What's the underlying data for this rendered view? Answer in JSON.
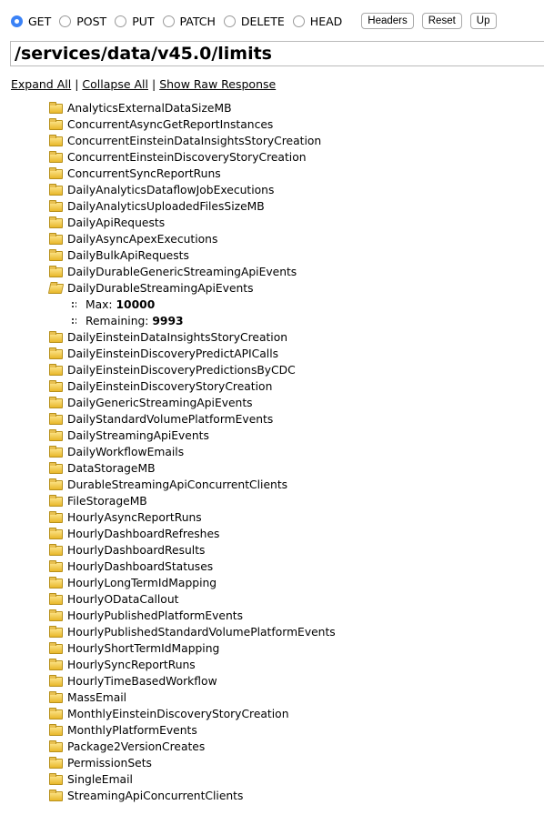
{
  "methods": [
    {
      "label": "GET",
      "selected": true
    },
    {
      "label": "POST",
      "selected": false
    },
    {
      "label": "PUT",
      "selected": false
    },
    {
      "label": "PATCH",
      "selected": false
    },
    {
      "label": "DELETE",
      "selected": false
    },
    {
      "label": "HEAD",
      "selected": false
    }
  ],
  "buttons": {
    "headers": "Headers",
    "reset": "Reset",
    "up": "Up"
  },
  "url": "/services/data/v45.0/limits",
  "links": {
    "expand": "Expand All",
    "sep": "|",
    "collapse": "Collapse All",
    "raw": "Show Raw Response"
  },
  "tree": [
    {
      "name": "AnalyticsExternalDataSizeMB"
    },
    {
      "name": "ConcurrentAsyncGetReportInstances"
    },
    {
      "name": "ConcurrentEinsteinDataInsightsStoryCreation"
    },
    {
      "name": "ConcurrentEinsteinDiscoveryStoryCreation"
    },
    {
      "name": "ConcurrentSyncReportRuns"
    },
    {
      "name": "DailyAnalyticsDataflowJobExecutions"
    },
    {
      "name": "DailyAnalyticsUploadedFilesSizeMB"
    },
    {
      "name": "DailyApiRequests"
    },
    {
      "name": "DailyAsyncApexExecutions"
    },
    {
      "name": "DailyBulkApiRequests"
    },
    {
      "name": "DailyDurableGenericStreamingApiEvents"
    },
    {
      "name": "DailyDurableStreamingApiEvents",
      "expanded": true,
      "children": [
        {
          "key": "Max:",
          "value": "10000"
        },
        {
          "key": "Remaining:",
          "value": "9993"
        }
      ]
    },
    {
      "name": "DailyEinsteinDataInsightsStoryCreation"
    },
    {
      "name": "DailyEinsteinDiscoveryPredictAPICalls"
    },
    {
      "name": "DailyEinsteinDiscoveryPredictionsByCDC"
    },
    {
      "name": "DailyEinsteinDiscoveryStoryCreation"
    },
    {
      "name": "DailyGenericStreamingApiEvents"
    },
    {
      "name": "DailyStandardVolumePlatformEvents"
    },
    {
      "name": "DailyStreamingApiEvents"
    },
    {
      "name": "DailyWorkflowEmails"
    },
    {
      "name": "DataStorageMB"
    },
    {
      "name": "DurableStreamingApiConcurrentClients"
    },
    {
      "name": "FileStorageMB"
    },
    {
      "name": "HourlyAsyncReportRuns"
    },
    {
      "name": "HourlyDashboardRefreshes"
    },
    {
      "name": "HourlyDashboardResults"
    },
    {
      "name": "HourlyDashboardStatuses"
    },
    {
      "name": "HourlyLongTermIdMapping"
    },
    {
      "name": "HourlyODataCallout"
    },
    {
      "name": "HourlyPublishedPlatformEvents"
    },
    {
      "name": "HourlyPublishedStandardVolumePlatformEvents"
    },
    {
      "name": "HourlyShortTermIdMapping"
    },
    {
      "name": "HourlySyncReportRuns"
    },
    {
      "name": "HourlyTimeBasedWorkflow"
    },
    {
      "name": "MassEmail"
    },
    {
      "name": "MonthlyEinsteinDiscoveryStoryCreation"
    },
    {
      "name": "MonthlyPlatformEvents"
    },
    {
      "name": "Package2VersionCreates"
    },
    {
      "name": "PermissionSets"
    },
    {
      "name": "SingleEmail"
    },
    {
      "name": "StreamingApiConcurrentClients"
    }
  ]
}
